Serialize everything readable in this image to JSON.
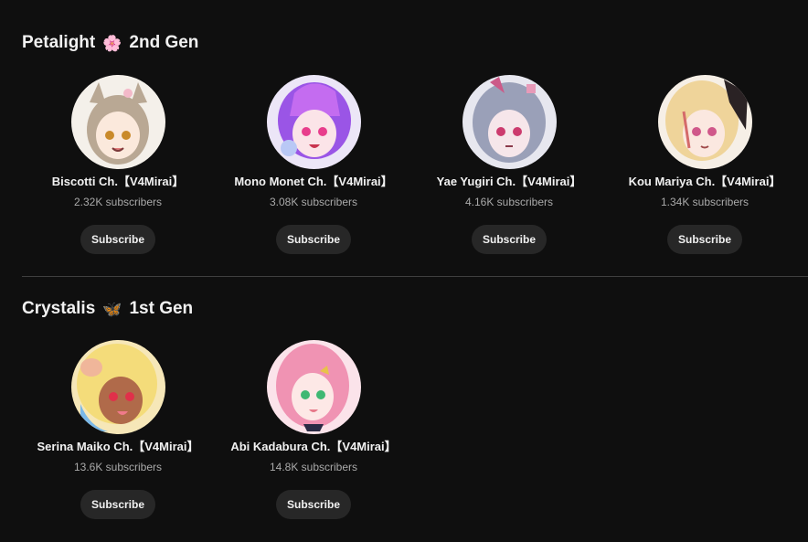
{
  "sections": [
    {
      "title_left": "Petalight",
      "title_icon": "🌸",
      "title_icon_name": "cherry-blossom-icon",
      "title_right": "2nd Gen",
      "channels": [
        {
          "name": "Biscotti Ch.【V4Mirai】",
          "subscribers": "2.32K subscribers",
          "button": "Subscribe",
          "avatar_colors": [
            "#f4f0ea",
            "#b9a894",
            "#7c6a58"
          ]
        },
        {
          "name": "Mono Monet Ch.【V4Mirai】",
          "subscribers": "3.08K subscribers",
          "button": "Subscribe",
          "avatar_colors": [
            "#ece6f7",
            "#9a55e6",
            "#e95bbf"
          ]
        },
        {
          "name": "Yae Yugiri Ch.【V4Mirai】",
          "subscribers": "4.16K subscribers",
          "button": "Subscribe",
          "avatar_colors": [
            "#e7e7ef",
            "#9aa0b8",
            "#cc5a88"
          ]
        },
        {
          "name": "Kou Mariya Ch.【V4Mirai】",
          "subscribers": "1.34K subscribers",
          "button": "Subscribe",
          "avatar_colors": [
            "#f6efe6",
            "#efd49a",
            "#d46a6a"
          ]
        }
      ]
    },
    {
      "title_left": "Crystalis",
      "title_icon": "🦋",
      "title_icon_name": "butterfly-icon",
      "title_right": "1st Gen",
      "channels": [
        {
          "name": "Serina Maiko Ch.【V4Mirai】",
          "subscribers": "13.6K subscribers",
          "button": "Subscribe",
          "avatar_colors": [
            "#f6e7b8",
            "#f4dc7a",
            "#b06a4a"
          ]
        },
        {
          "name": "Abi Kadabura Ch.【V4Mirai】",
          "subscribers": "14.8K subscribers",
          "button": "Subscribe",
          "avatar_colors": [
            "#fbe3ea",
            "#f093b3",
            "#5ec98a"
          ]
        }
      ]
    }
  ]
}
